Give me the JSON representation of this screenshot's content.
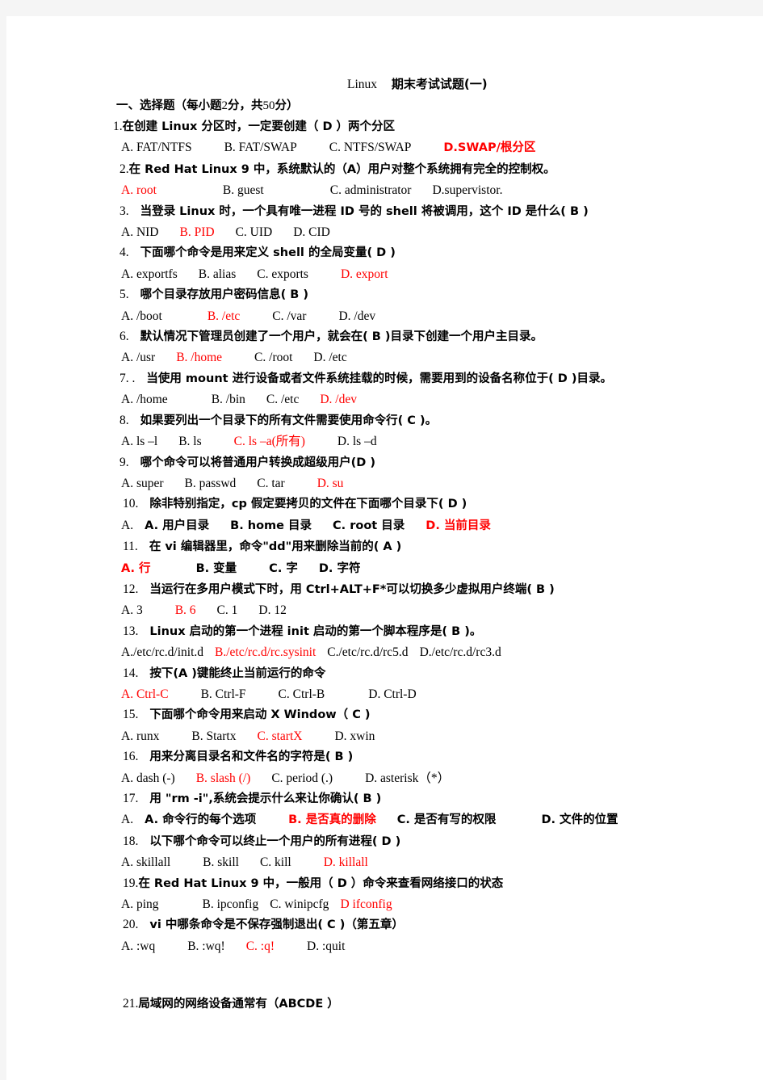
{
  "document": {
    "title_latin": "Linux",
    "title_cn": "期末考试试题(一)",
    "section_heading_cn": "一、选择题（每小题",
    "section_heading_num1": "2",
    "section_heading_cn2": "分，共",
    "section_heading_num2": "50",
    "section_heading_cn3": "分）",
    "accent_color": "#ff0000",
    "text_color": "#000000",
    "page_background": "#ffffff",
    "canvas_background": "#f5f5f5"
  },
  "questions": [
    {
      "number": "1.",
      "stem": "在创建 Linux 分区时，一定要创建（ D ）两个分区",
      "options": [
        {
          "label": "A. FAT/NTFS",
          "red": false
        },
        {
          "label": "B. FAT/SWAP",
          "red": false
        },
        {
          "label": "C. NTFS/SWAP",
          "red": false
        },
        {
          "label": "D.SWAP/根分区",
          "red": true
        }
      ]
    },
    {
      "number": "2.",
      "stem": "在 Red Hat Linux 9 中，系统默认的（A）用户对整个系统拥有完全的控制权。",
      "options": [
        {
          "label": "A. root",
          "red": true
        },
        {
          "label": "B. guest",
          "red": false
        },
        {
          "label": "C. administrator",
          "red": false
        },
        {
          "label": "D.supervistor.",
          "red": false
        }
      ]
    },
    {
      "number": "3.",
      "stem": "当登录 Linux 时，一个具有唯一进程 ID 号的 shell 将被调用，这个 ID 是什么( B  )",
      "options": [
        {
          "label": "A. NID",
          "red": false
        },
        {
          "label": "B. PID",
          "red": true
        },
        {
          "label": "C. UID",
          "red": false
        },
        {
          "label": "D. CID",
          "red": false
        }
      ]
    },
    {
      "number": "4.",
      "stem": "下面哪个命令是用来定义 shell 的全局变量(  D  )",
      "options": [
        {
          "label": "A. exportfs",
          "red": false
        },
        {
          "label": "B. alias",
          "red": false
        },
        {
          "label": "C. exports",
          "red": false
        },
        {
          "label": "D. export",
          "red": true
        }
      ]
    },
    {
      "number": "5.",
      "stem": "哪个目录存放用户密码信息( B  )",
      "options": [
        {
          "label": "A. /boot",
          "red": false
        },
        {
          "label": "B. /etc",
          "red": true
        },
        {
          "label": "C. /var",
          "red": false
        },
        {
          "label": "D. /dev",
          "red": false
        }
      ]
    },
    {
      "number": "6.",
      "stem": "默认情况下管理员创建了一个用户，就会在( B  )目录下创建一个用户主目录。",
      "options": [
        {
          "label": "A. /usr",
          "red": false
        },
        {
          "label": "B. /home",
          "red": true
        },
        {
          "label": "C. /root",
          "red": false
        },
        {
          "label": "D. /etc",
          "red": false
        }
      ]
    },
    {
      "number": "7. .",
      "stem": "当使用 mount 进行设备或者文件系统挂载的时候，需要用到的设备名称位于( D )目录。",
      "options": [
        {
          "label": "A. /home",
          "red": false
        },
        {
          "label": "B. /bin",
          "red": false
        },
        {
          "label": "C. /etc",
          "red": false
        },
        {
          "label": "D. /dev",
          "red": true
        }
      ]
    },
    {
      "number": "8.",
      "stem": "如果要列出一个目录下的所有文件需要使用命令行( C   )。",
      "options": [
        {
          "label": "A. ls –l",
          "red": false
        },
        {
          "label": "B. ls",
          "red": false
        },
        {
          "label": "C. ls –a(所有)",
          "red": true
        },
        {
          "label": "D. ls –d",
          "red": false
        }
      ]
    },
    {
      "number": "9.",
      "stem": "哪个命令可以将普通用户转换成超级用户(D )",
      "options": [
        {
          "label": "A. super",
          "red": false
        },
        {
          "label": "B. passwd",
          "red": false
        },
        {
          "label": "C. tar",
          "red": false
        },
        {
          "label": "D. su",
          "red": true
        }
      ]
    },
    {
      "number": "10.",
      "stem": "除非特别指定，cp 假定要拷贝的文件在下面哪个目录下( D   )",
      "options": [
        {
          "label": "A. 用户目录",
          "red": false
        },
        {
          "label": "B. home 目录",
          "red": false
        },
        {
          "label": "C. root 目录",
          "red": false
        },
        {
          "label": "D. 当前目录",
          "red": true
        }
      ]
    },
    {
      "number": "11.",
      "stem": "在 vi 编辑器里，命令\"dd\"用来删除当前的( A )",
      "options": [
        {
          "label": "A. 行",
          "red": true
        },
        {
          "label": "B. 变量",
          "red": false
        },
        {
          "label": "C. 字",
          "red": false
        },
        {
          "label": "D. 字符",
          "red": false
        }
      ]
    },
    {
      "number": "12.",
      "stem": "当运行在多用户模式下时，用 Ctrl+ALT+F*可以切换多少虚拟用户终端( B  )",
      "options": [
        {
          "label": "A. 3",
          "red": false
        },
        {
          "label": "B. 6",
          "red": true
        },
        {
          "label": "C. 1",
          "red": false
        },
        {
          "label": "D. 12",
          "red": false
        }
      ]
    },
    {
      "number": "13.",
      "stem": "Linux 启动的第一个进程 init 启动的第一个脚本程序是( B  )。",
      "options": [
        {
          "label": "A./etc/rc.d/init.d",
          "red": false
        },
        {
          "label": "B./etc/rc.d/rc.sysinit",
          "red": true
        },
        {
          "label": "C./etc/rc.d/rc5.d",
          "red": false
        },
        {
          "label": "D./etc/rc.d/rc3.d",
          "red": false
        }
      ]
    },
    {
      "number": "14.",
      "stem": "按下(A    )键能终止当前运行的命令",
      "options": [
        {
          "label": "A. Ctrl-C",
          "red": true
        },
        {
          "label": "B. Ctrl-F",
          "red": false
        },
        {
          "label": "C. Ctrl-B",
          "red": false
        },
        {
          "label": "D. Ctrl-D",
          "red": false
        }
      ]
    },
    {
      "number": "15.",
      "stem": "下面哪个命令用来启动 X Window（ C   )",
      "options": [
        {
          "label": "A. runx",
          "red": false
        },
        {
          "label": "B. Startx",
          "red": false
        },
        {
          "label": "C. startX",
          "red": true
        },
        {
          "label": "D. xwin",
          "red": false
        }
      ]
    },
    {
      "number": "16.",
      "stem": "用来分离目录名和文件名的字符是( B   )",
      "options": [
        {
          "label": "A. dash (-)",
          "red": false
        },
        {
          "label": "B. slash (/)",
          "red": true
        },
        {
          "label": "C. period (.)",
          "red": false
        },
        {
          "label": "D. asterisk（*）",
          "red": false
        }
      ]
    },
    {
      "number": "17.",
      "stem": "用 \"rm -i\",系统会提示什么来让你确认(  B  )",
      "options": [
        {
          "label": "A. 命令行的每个选项",
          "red": false
        },
        {
          "label": "B. 是否真的删除",
          "red": true
        },
        {
          "label": "C. 是否有写的权限",
          "red": false
        },
        {
          "label": "D. 文件的位置",
          "red": false
        }
      ]
    },
    {
      "number": "18.",
      "stem": "以下哪个命令可以终止一个用户的所有进程( D   )",
      "options": [
        {
          "label": "A. skillall",
          "red": false
        },
        {
          "label": "B. skill",
          "red": false
        },
        {
          "label": "C. kill",
          "red": false
        },
        {
          "label": "D. killall",
          "red": true
        }
      ]
    },
    {
      "number": "19.",
      "stem": "在 Red Hat Linux 9 中，一般用（ D  ）命令来查看网络接口的状态",
      "options": [
        {
          "label": "A. ping",
          "red": false
        },
        {
          "label": "B. ipconfig",
          "red": false
        },
        {
          "label": "C. winipcfg",
          "red": false
        },
        {
          "label": "D   ifconfig",
          "red": true
        }
      ]
    },
    {
      "number": "20.",
      "stem": "vi 中哪条命令是不保存强制退出( C   )（第五章）",
      "options": [
        {
          "label": "A. :wq",
          "red": false
        },
        {
          "label": "B. :wq!",
          "red": false
        },
        {
          "label": "C. :q!",
          "red": true
        },
        {
          "label": "D. :quit",
          "red": false
        }
      ]
    },
    {
      "number": "21.",
      "stem": "局域网的网络设备通常有（ABCDE    ）",
      "options": []
    }
  ]
}
